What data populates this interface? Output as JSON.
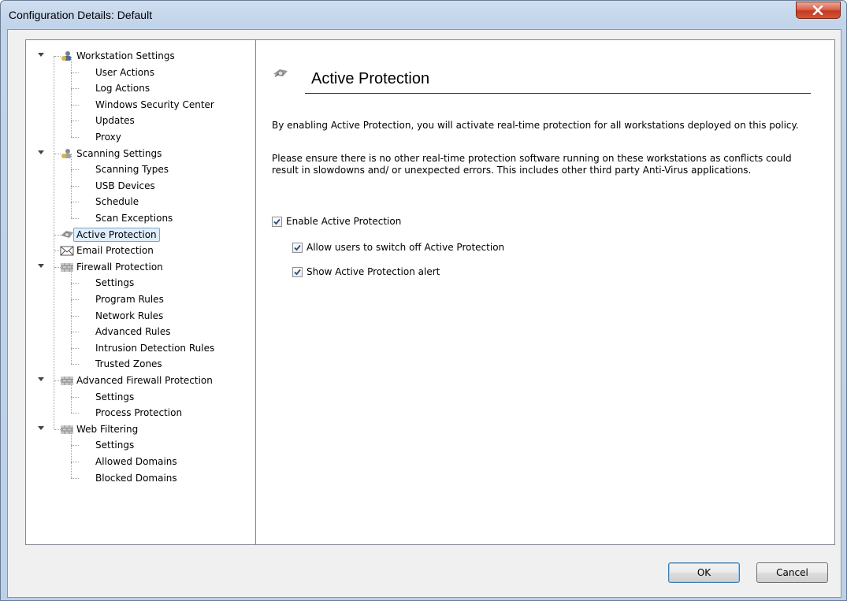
{
  "window": {
    "title": "Configuration Details: Default"
  },
  "tree": [
    {
      "label": "Workstation Settings",
      "level": 0,
      "expanded": true,
      "icon": "users-gear-icon"
    },
    {
      "label": "User Actions",
      "level": 1
    },
    {
      "label": "Log Actions",
      "level": 1
    },
    {
      "label": "Windows Security Center",
      "level": 1
    },
    {
      "label": "Updates",
      "level": 1
    },
    {
      "label": "Proxy",
      "level": 1
    },
    {
      "label": "Scanning Settings",
      "level": 0,
      "expanded": true,
      "icon": "magnifier-person-icon"
    },
    {
      "label": "Scanning Types",
      "level": 1
    },
    {
      "label": "USB Devices",
      "level": 1
    },
    {
      "label": "Schedule",
      "level": 1
    },
    {
      "label": "Scan Exceptions",
      "level": 1
    },
    {
      "label": "Active Protection",
      "level": 0,
      "selected": true,
      "icon": "shield-gear-icon"
    },
    {
      "label": "Email Protection",
      "level": 0,
      "icon": "envelope-icon"
    },
    {
      "label": "Firewall Protection",
      "level": 0,
      "expanded": true,
      "icon": "firewall-icon"
    },
    {
      "label": "Settings",
      "level": 1
    },
    {
      "label": "Program Rules",
      "level": 1
    },
    {
      "label": "Network Rules",
      "level": 1
    },
    {
      "label": "Advanced Rules",
      "level": 1
    },
    {
      "label": "Intrusion Detection Rules",
      "level": 1
    },
    {
      "label": "Trusted Zones",
      "level": 1
    },
    {
      "label": "Advanced Firewall Protection",
      "level": 0,
      "expanded": true,
      "icon": "firewall-icon"
    },
    {
      "label": "Settings",
      "level": 1
    },
    {
      "label": "Process Protection",
      "level": 1
    },
    {
      "label": "Web Filtering",
      "level": 0,
      "expanded": true,
      "icon": "firewall-icon"
    },
    {
      "label": "Settings",
      "level": 1
    },
    {
      "label": "Allowed Domains",
      "level": 1
    },
    {
      "label": "Blocked Domains",
      "level": 1
    }
  ],
  "content": {
    "title": "Active Protection",
    "icon": "shield-gear-icon",
    "description1": "By enabling Active Protection, you will activate real-time protection for all workstations deployed on this policy.",
    "description2": "Please ensure there is no other real-time protection software running on these workstations as conflicts could result in slowdowns and/ or unexpected errors. This includes other third party Anti-Virus applications.",
    "enable_label": "Enable Active Protection",
    "enable_checked": true,
    "allow_switch_off_label": "Allow users to switch off Active Protection",
    "allow_switch_off_checked": true,
    "show_alert_label": "Show Active Protection alert",
    "show_alert_checked": true
  },
  "buttons": {
    "ok": "OK",
    "cancel": "Cancel"
  }
}
